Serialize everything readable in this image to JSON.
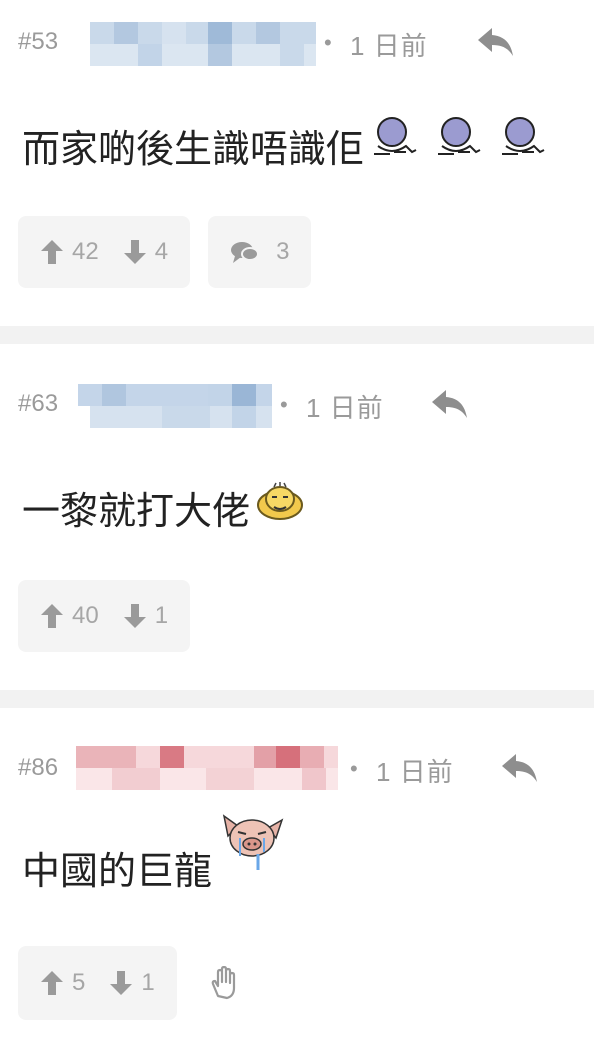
{
  "threads": [
    {
      "floor": "#53",
      "dot": "•",
      "time": "1 日前",
      "text": "而家啲後生識唔識佢",
      "upvotes": "42",
      "downvotes": "4",
      "comments": "3",
      "username_color": "#b9cde3"
    },
    {
      "floor": "#63",
      "dot": "•",
      "time": "1 日前",
      "text": "一黎就打大佬",
      "upvotes": "40",
      "downvotes": "1",
      "username_color": "#b9cde3"
    },
    {
      "floor": "#86",
      "dot": "•",
      "time": "1 日前",
      "text": "中國的巨龍",
      "upvotes": "5",
      "downvotes": "1",
      "username_color": "#f2c2c6"
    }
  ],
  "icons": {
    "reply": "reply-icon",
    "upvote": "arrow-up-icon",
    "downvote": "arrow-down-icon",
    "comment": "speech-bubbles-icon",
    "hand": "raised-hand-icon"
  },
  "colors": {
    "meta_text": "#9a9a9a",
    "count_text": "#a6a6a6",
    "box_bg": "#f4f4f4",
    "divider": "#f2f2f2"
  }
}
